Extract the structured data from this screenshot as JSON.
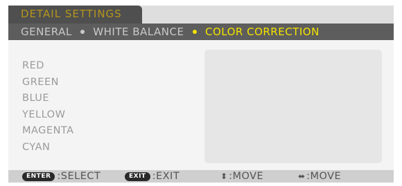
{
  "title": "DETAIL SETTINGS",
  "breadcrumb": [
    "GENERAL",
    "WHITE BALANCE",
    "COLOR CORRECTION"
  ],
  "items": [
    "RED",
    "GREEN",
    "BLUE",
    "YELLOW",
    "MAGENTA",
    "CYAN"
  ],
  "footer": {
    "enter_key": "ENTER",
    "enter_label": ":SELECT",
    "exit_key": "EXIT",
    "exit_label": ":EXIT",
    "updown_icon": "up-down-arrows-icon",
    "updown_label": ":MOVE",
    "leftright_icon": "left-right-arrows-icon",
    "leftright_label": ":MOVE"
  },
  "colors": {
    "title_text": "#b5961c",
    "active_breadcrumb": "#f5e400",
    "tab_background": "#4f4f4f",
    "breadcrumb_background": "#5d5d5d"
  }
}
